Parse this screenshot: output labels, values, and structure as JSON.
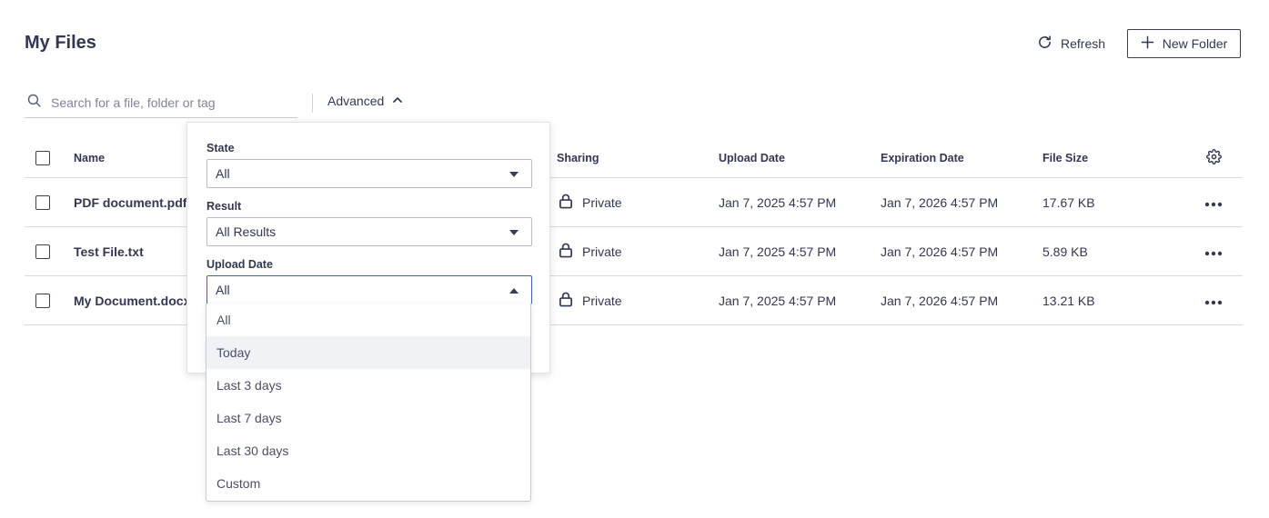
{
  "header": {
    "title": "My Files",
    "refresh_label": "Refresh",
    "new_folder_label": "New Folder"
  },
  "search": {
    "placeholder": "Search for a file, folder or tag",
    "value": ""
  },
  "advanced": {
    "label": "Advanced",
    "expanded": true,
    "state": {
      "label": "State",
      "value": "All"
    },
    "result": {
      "label": "Result",
      "value": "All Results"
    },
    "upload_date": {
      "label": "Upload Date",
      "value": "All",
      "options": [
        "All",
        "Today",
        "Last 3 days",
        "Last 7 days",
        "Last 30 days",
        "Custom"
      ],
      "hovered_option": "Today"
    }
  },
  "table": {
    "columns": {
      "name": "Name",
      "sharing": "Sharing",
      "upload_date": "Upload Date",
      "expiration_date": "Expiration Date",
      "file_size": "File Size"
    },
    "rows": [
      {
        "name": "PDF document.pdf",
        "sharing": "Private",
        "upload_date": "Jan 7, 2025 4:57 PM",
        "expiration_date": "Jan 7, 2026 4:57 PM",
        "file_size": "17.67 KB"
      },
      {
        "name": "Test File.txt",
        "sharing": "Private",
        "upload_date": "Jan 7, 2025 4:57 PM",
        "expiration_date": "Jan 7, 2026 4:57 PM",
        "file_size": "5.89 KB"
      },
      {
        "name": "My Document.docx",
        "sharing": "Private",
        "upload_date": "Jan 7, 2025 4:57 PM",
        "expiration_date": "Jan 7, 2026 4:57 PM",
        "file_size": "13.21 KB"
      }
    ]
  },
  "icons": {
    "refresh": "refresh-icon",
    "add": "plus-icon",
    "search": "search-icon",
    "chevron": "chevron-up-icon",
    "lock": "lock-icon",
    "more": "more-horizontal-icon",
    "settings": "gear-icon"
  },
  "colors": {
    "text": "#333850",
    "border": "#d8dae1",
    "focus": "#3a62b8",
    "hover": "#f1f2f5"
  }
}
